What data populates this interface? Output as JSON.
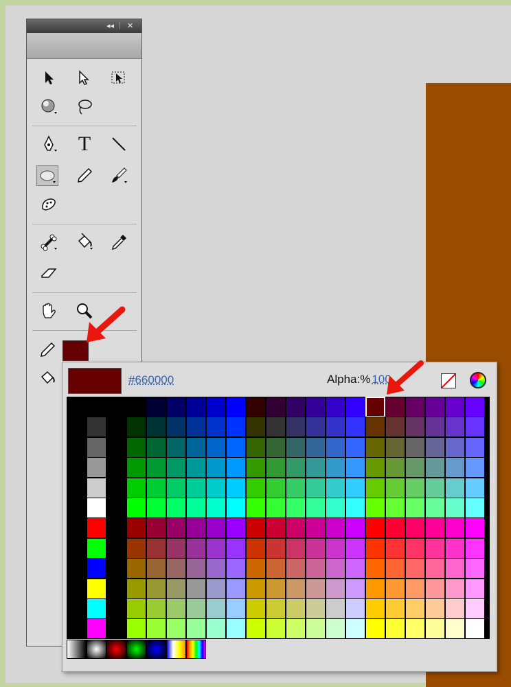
{
  "panel": {
    "title_controls": [
      "◂◂",
      "|",
      "✕"
    ],
    "tools": [
      {
        "name": "selection-tool",
        "icon": "arrow-icon"
      },
      {
        "name": "subselection-tool",
        "icon": "subselect-arrow-icon"
      },
      {
        "name": "free-transform-tool",
        "icon": "transform-icon"
      },
      {
        "name": "3d-rotation-tool",
        "icon": "sphere-icon"
      },
      {
        "name": "lasso-tool",
        "icon": "lasso-icon"
      },
      {
        "name": "pen-tool",
        "icon": "pen-icon"
      },
      {
        "name": "text-tool",
        "icon": "text-icon",
        "label": "T"
      },
      {
        "name": "line-tool",
        "icon": "line-icon"
      },
      {
        "name": "oval-tool",
        "icon": "oval-icon"
      },
      {
        "name": "pencil-tool",
        "icon": "pencil-icon"
      },
      {
        "name": "brush-tool",
        "icon": "brush-icon"
      },
      {
        "name": "deco-tool",
        "icon": "deco-icon"
      },
      {
        "name": "bone-tool",
        "icon": "bone-icon"
      },
      {
        "name": "paint-bucket-tool",
        "icon": "bucket-icon"
      },
      {
        "name": "eyedropper-tool",
        "icon": "eyedropper-icon"
      },
      {
        "name": "eraser-tool",
        "icon": "eraser-icon"
      },
      {
        "name": "hand-tool",
        "icon": "hand-icon"
      },
      {
        "name": "zoom-tool",
        "icon": "magnifier-icon"
      }
    ],
    "stroke_color": "#660000",
    "fill_color": "#660000"
  },
  "swatches": {
    "hex_value": "#660000",
    "alpha_label": "Alpha:%",
    "alpha_value": "100",
    "selected_color": "#660000"
  },
  "canvas": {
    "shape_color": "#994C00"
  },
  "colors": {
    "annotation_arrow": "#e8160c"
  }
}
